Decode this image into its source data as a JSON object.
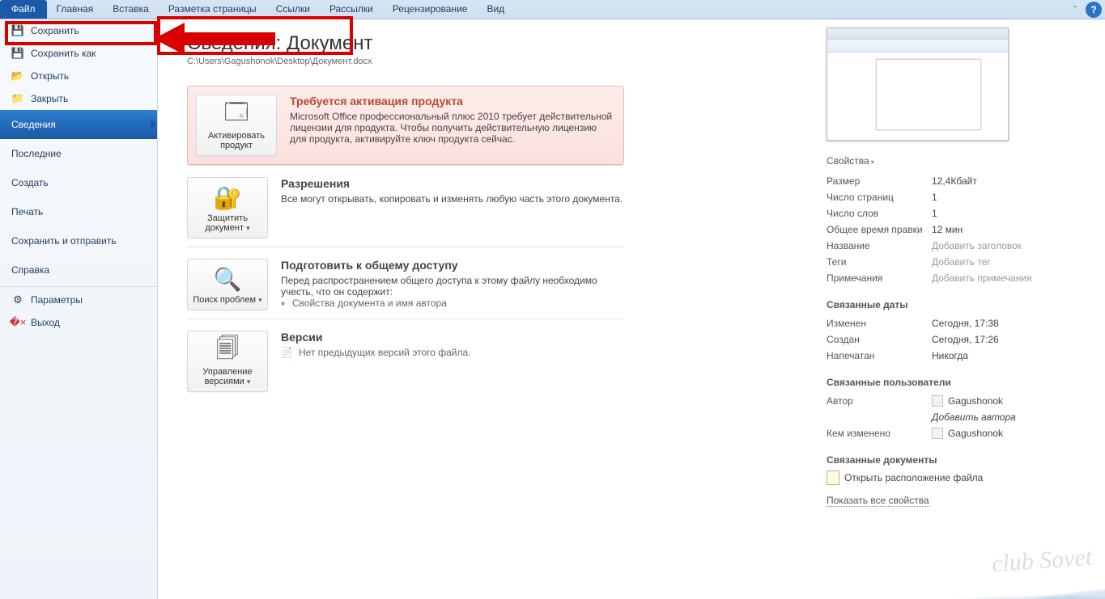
{
  "ribbon": {
    "tabs": [
      "Файл",
      "Главная",
      "Вставка",
      "Разметка страницы",
      "Ссылки",
      "Рассылки",
      "Рецензирование",
      "Вид"
    ]
  },
  "sidebar": {
    "save": "Сохранить",
    "save_as": "Сохранить как",
    "open": "Открыть",
    "close": "Закрыть",
    "info": "Сведения",
    "recent": "Последние",
    "new": "Создать",
    "print": "Печать",
    "share": "Сохранить и отправить",
    "help": "Справка",
    "options": "Параметры",
    "exit": "Выход"
  },
  "info": {
    "title": "Сведения: Документ",
    "path": "C:\\Users\\Gagushonok\\Desktop\\Документ.docx",
    "activation": {
      "btn": "Активировать продукт",
      "head": "Требуется активация продукта",
      "body": "Microsoft Office профессиональный плюс 2010 требует действительной лицензии для продукта. Чтобы получить действительную лицензию для продукта, активируйте ключ продукта сейчас."
    },
    "permissions": {
      "btn": "Защитить документ",
      "head": "Разрешения",
      "body": "Все могут открывать, копировать и изменять любую часть этого документа."
    },
    "prepare": {
      "btn": "Поиск проблем",
      "head": "Подготовить к общему доступу",
      "body": "Перед распространением общего доступа к этому файлу необходимо учесть, что он содержит:",
      "bullet": "Свойства документа и имя автора"
    },
    "versions": {
      "btn": "Управление версиями",
      "head": "Версии",
      "line": "Нет предыдущих версий этого файла."
    }
  },
  "props": {
    "header": "Свойства",
    "size_k": "Размер",
    "size_v": "12,4Кбайт",
    "pages_k": "Число страниц",
    "pages_v": "1",
    "words_k": "Число слов",
    "words_v": "1",
    "edit_k": "Общее время правки",
    "edit_v": "12 мин",
    "title_k": "Название",
    "title_ph": "Добавить заголовок",
    "tags_k": "Теги",
    "tags_ph": "Добавить тег",
    "notes_k": "Примечания",
    "notes_ph": "Добавить примечания",
    "dates_h": "Связанные даты",
    "mod_k": "Изменен",
    "mod_v": "Сегодня, 17:38",
    "cre_k": "Создан",
    "cre_v": "Сегодня, 17:26",
    "prn_k": "Напечатан",
    "prn_v": "Никогда",
    "people_h": "Связанные пользователи",
    "author_k": "Автор",
    "author_v": "Gagushonok",
    "add_author": "Добавить автора",
    "lastmod_k": "Кем изменено",
    "lastmod_v": "Gagushonok",
    "docs_h": "Связанные документы",
    "open_loc": "Открыть расположение файла",
    "show_all": "Показать все свойства"
  },
  "watermark": "club Sovet"
}
